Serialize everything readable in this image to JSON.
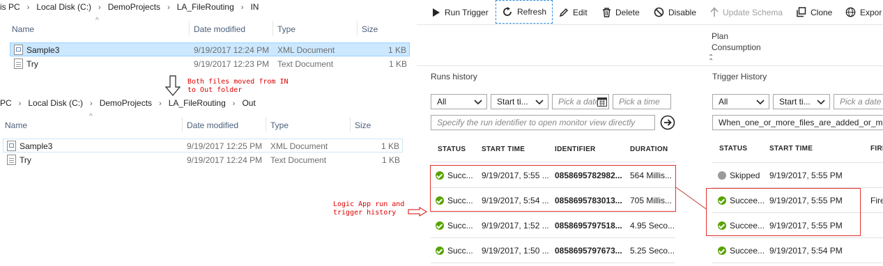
{
  "explorer_in": {
    "breadcrumb": [
      "is PC",
      "Local Disk (C:)",
      "DemoProjects",
      "LA_FileRouting",
      "IN"
    ],
    "columns": [
      "Name",
      "Date modified",
      "Type",
      "Size"
    ],
    "rows": [
      {
        "name": "Sample3",
        "date": "9/19/2017 12:24 PM",
        "type": "XML Document",
        "size": "1 KB",
        "icon": "xml-file-icon",
        "selected": true
      },
      {
        "name": "Try",
        "date": "9/19/2017 12:23 PM",
        "type": "Text Document",
        "size": "1 KB",
        "icon": "text-file-icon"
      }
    ]
  },
  "explorer_out": {
    "breadcrumb": [
      "PC",
      "Local Disk (C:)",
      "DemoProjects",
      "LA_FileRouting",
      "Out"
    ],
    "columns": [
      "Name",
      "Date modified",
      "Type",
      "Size"
    ],
    "rows": [
      {
        "name": "Sample3",
        "date": "9/19/2017 12:25 PM",
        "type": "XML Document",
        "size": "1 KB",
        "icon": "xml-file-icon"
      },
      {
        "name": "Try",
        "date": "9/19/2017 12:24 PM",
        "type": "Text Document",
        "size": "1 KB",
        "icon": "text-file-icon"
      }
    ]
  },
  "annotations": {
    "moved": "Both files moved from IN\nto Out folder",
    "logic_app": "Logic App run and\ntrigger history"
  },
  "toolbar": {
    "run_trigger": "Run Trigger",
    "refresh": "Refresh",
    "edit": "Edit",
    "delete": "Delete",
    "disable": "Disable",
    "update_schema": "Update Schema",
    "clone": "Clone",
    "export": "Expor"
  },
  "plan": {
    "label": "Plan",
    "value": "Consumption"
  },
  "runs": {
    "title": "Runs history",
    "filter_status": "All",
    "start_time": "Start ti...",
    "date_placeholder": "Pick a date",
    "time_placeholder": "Pick a time",
    "search_placeholder": "Specify the run identifier to open monitor view directly",
    "headers": [
      "STATUS",
      "START TIME",
      "IDENTIFIER",
      "DURATION"
    ],
    "rows": [
      {
        "status": "Succ...",
        "start": "9/19/2017, 5:55 ...",
        "id": "0858695782982...",
        "duration": "564 Millis..."
      },
      {
        "status": "Succ...",
        "start": "9/19/2017, 5:54 ...",
        "id": "0858695783013...",
        "duration": "705 Millis..."
      },
      {
        "status": "Succ...",
        "start": "9/19/2017, 1:52 ...",
        "id": "0858695797518...",
        "duration": "4.95 Seco..."
      },
      {
        "status": "Succ...",
        "start": "9/19/2017, 1:50 ...",
        "id": "0858695797673...",
        "duration": "5.25 Seco..."
      }
    ]
  },
  "trigger": {
    "title": "Trigger History",
    "filter_status": "All",
    "start_time": "Start ti...",
    "date_placeholder": "Pick a date",
    "trigger_name": "When_one_or_more_files_are_added_or_mod",
    "headers": [
      "STATUS",
      "START TIME",
      "FIRI"
    ],
    "rows": [
      {
        "status": "Skipped",
        "start": "9/19/2017, 5:55 PM",
        "fired": "",
        "kind": "skipped"
      },
      {
        "status": "Succee...",
        "start": "9/19/2017, 5:55 PM",
        "fired": "Fire",
        "kind": "ok"
      },
      {
        "status": "Succee...",
        "start": "9/19/2017, 5:55 PM",
        "fired": "",
        "kind": "ok"
      },
      {
        "status": "Succee...",
        "start": "9/19/2017, 5:54 PM",
        "fired": "",
        "kind": "ok"
      }
    ]
  },
  "colors": {
    "success": "#57a300",
    "skipped": "#9a9a9a",
    "highlight": "#e0302a",
    "selection": "#cce8ff"
  }
}
